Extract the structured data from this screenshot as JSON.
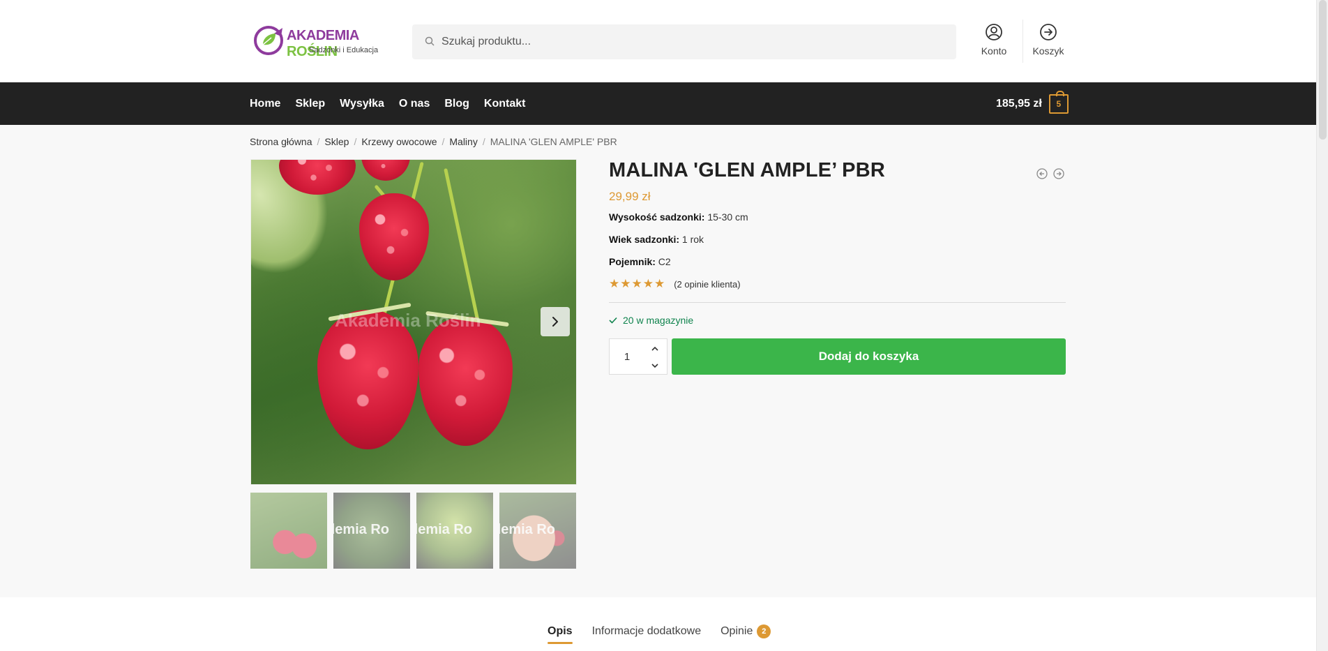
{
  "header": {
    "logo_main_1": "AKADEMIA",
    "logo_main_2": "ROŚLIN",
    "logo_sub": "Sadzonki i Edukacja",
    "search_placeholder": "Szukaj produktu...",
    "account_label": "Konto",
    "cart_label": "Koszyk"
  },
  "nav": {
    "items": [
      "Home",
      "Sklep",
      "Wysyłka",
      "O nas",
      "Blog",
      "Kontakt"
    ],
    "cart_amount": "185,95 zł",
    "cart_count": "5"
  },
  "breadcrumb": {
    "items": [
      "Strona główna",
      "Sklep",
      "Krzewy owocowe",
      "Maliny"
    ],
    "current": "MALINA 'GLEN AMPLE' PBR",
    "separator": "/"
  },
  "gallery": {
    "watermark": "Akademia Roślin",
    "thumb_watermark": "demia Ro"
  },
  "product": {
    "title": "MALINA 'GLEN AMPLE’ PBR",
    "price": "29,99 zł",
    "attributes": [
      {
        "label": "Wysokość sadzonki:",
        "value": "15-30 cm"
      },
      {
        "label": "Wiek sadzonki:",
        "value": "1 rok"
      },
      {
        "label": "Pojemnik:",
        "value": "C2"
      }
    ],
    "rating_stars": "★★★★★",
    "rating_value": 5,
    "reviews_text": "(2 opinie klienta)",
    "stock_text": "20 w magazynie",
    "quantity": "1",
    "add_to_cart": "Dodaj do koszyka"
  },
  "tabs": {
    "items": [
      {
        "label": "Opis",
        "active": true
      },
      {
        "label": "Informacje dodatkowe",
        "active": false
      },
      {
        "label": "Opinie",
        "active": false,
        "badge": "2"
      }
    ]
  },
  "colors": {
    "accent": "#dd9933",
    "nav_bg": "#222222",
    "add_button": "#3bb54a",
    "stock": "#0f834d",
    "logo_purple": "#8e3b9d",
    "logo_green": "#7cc242"
  }
}
